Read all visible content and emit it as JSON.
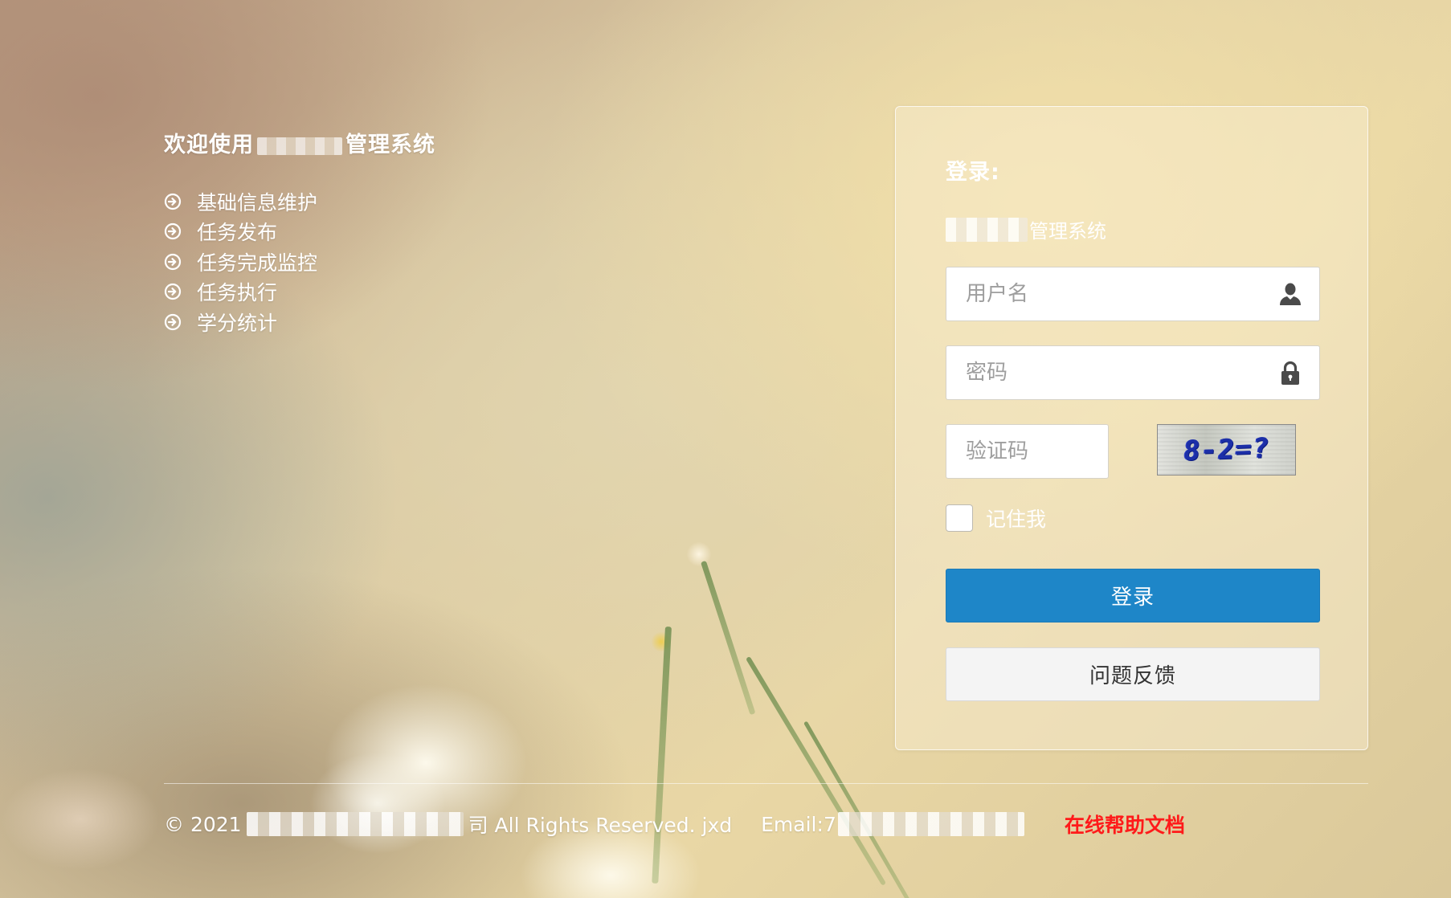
{
  "welcome": {
    "prefix": "欢迎使用",
    "suffix": "管理系统"
  },
  "features": [
    {
      "label": "基础信息维护",
      "icon": "circle-arrow-right-icon"
    },
    {
      "label": "任务发布",
      "icon": "circle-arrow-right-icon"
    },
    {
      "label": "任务完成监控",
      "icon": "circle-arrow-right-icon"
    },
    {
      "label": "任务执行",
      "icon": "circle-arrow-right-icon"
    },
    {
      "label": "学分统计",
      "icon": "circle-arrow-right-icon"
    }
  ],
  "login": {
    "title": "登录:",
    "system_name": "管理系统",
    "username_placeholder": "用户名",
    "username_icon": "user-icon",
    "password_placeholder": "密码",
    "password_icon": "lock-icon",
    "captcha_placeholder": "验证码",
    "captcha_image_text": "8-2=?",
    "remember_label": "记住我",
    "remember_checked": false,
    "login_button": "登录",
    "feedback_button": "问题反馈"
  },
  "footer": {
    "copyright_prefix": "© 2021",
    "copyright_suffix": "司 All Rights Reserved. jxd",
    "email_label": "Email:",
    "email_value_prefix": "7",
    "help_link": "在线帮助文档"
  },
  "colors": {
    "primary_button": "#1e86c8",
    "help_link": "#ff1a1a",
    "captcha_text": "#1c2fa8"
  }
}
